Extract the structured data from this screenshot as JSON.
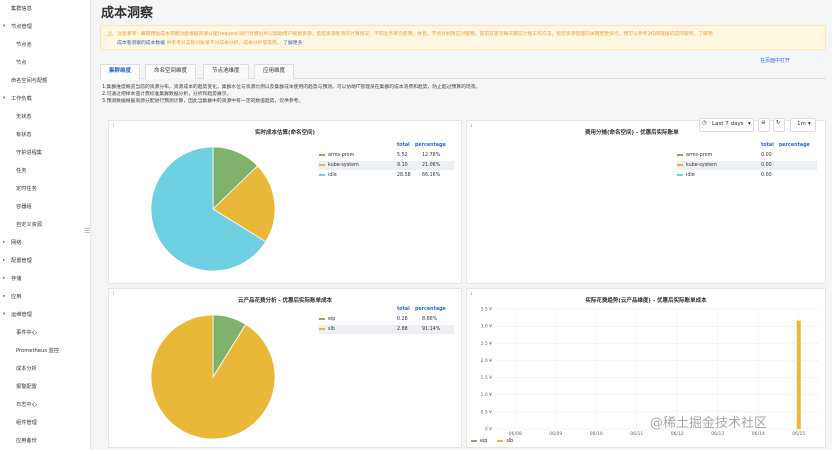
{
  "sidebar": {
    "items": [
      {
        "label": "集群信息",
        "level": 0,
        "caret": ""
      },
      {
        "label": "节点管理",
        "level": 0,
        "caret": "▾"
      },
      {
        "label": "节点池",
        "level": 1,
        "caret": ""
      },
      {
        "label": "节点",
        "level": 1,
        "caret": ""
      },
      {
        "label": "命名空间与配额",
        "level": 0,
        "caret": ""
      },
      {
        "label": "工作负载",
        "level": 0,
        "caret": "▾"
      },
      {
        "label": "无状态",
        "level": 1,
        "caret": ""
      },
      {
        "label": "有状态",
        "level": 1,
        "caret": ""
      },
      {
        "label": "守护进程集",
        "level": 1,
        "caret": ""
      },
      {
        "label": "任务",
        "level": 1,
        "caret": ""
      },
      {
        "label": "定时任务",
        "level": 1,
        "caret": ""
      },
      {
        "label": "容器组",
        "level": 1,
        "caret": ""
      },
      {
        "label": "自定义资源",
        "level": 1,
        "caret": ""
      },
      {
        "label": "网络",
        "level": 0,
        "caret": "▸"
      },
      {
        "label": "配置管理",
        "level": 0,
        "caret": "▸"
      },
      {
        "label": "存储",
        "level": 0,
        "caret": "▸"
      },
      {
        "label": "应用",
        "level": 0,
        "caret": "▸"
      },
      {
        "label": "运维管理",
        "level": 0,
        "caret": "▾"
      },
      {
        "label": "事件中心",
        "level": 1,
        "caret": ""
      },
      {
        "label": "Prometheus 监控",
        "level": 1,
        "caret": ""
      },
      {
        "label": "成本分析",
        "level": 1,
        "caret": ""
      },
      {
        "label": "报警配置",
        "level": 1,
        "caret": ""
      },
      {
        "label": "日志中心",
        "level": 1,
        "caret": ""
      },
      {
        "label": "组件管理",
        "level": 1,
        "caret": ""
      },
      {
        "label": "应用备份",
        "level": 1,
        "caret": ""
      }
    ],
    "collapse_glyph": "☰"
  },
  "page": {
    "title": "成本洞察",
    "open_new": "在页面中打开",
    "watermark": "@稀土掘金技术社区"
  },
  "notice": {
    "line1": "注意事项：每隔预估成本洞察功能根据资源分配(request)进行计费分析以帮助用户规划资源，监控资源各项的计算情况、不同业务单元使用、并且，节点计划用应对策略，提前在首次每天都在计划工作方法，帮您资源管理的关键更更多行，预可以参考对1网链接的实际服务。了解更",
    "line2_link": "成本看洞察的成本数据",
    "line2_text": "供参考对实际对账单不对成本分析、成本分析等等用。",
    "line2_link2": "了解更多",
    "warn_icon": "⚠"
  },
  "tabs": [
    {
      "label": "集群维度",
      "active": true
    },
    {
      "label": "命名空间维度",
      "active": false
    },
    {
      "label": "节点池维度",
      "active": false
    },
    {
      "label": "应用维度",
      "active": false
    }
  ],
  "description": [
    "1.集群维度概览当前的资源分布，资源成本的趋势变化，集群水位与资源比例以及集群成本使用的趋势与预测。可以协助IT管理员在集群的成本消费和趋势，防止超过预算的场景。",
    "2.可通过把样本值计费标准集群数据分析，分析和趋势展示。",
    "3.预测数据根据资源分配进行预测计算，因此当集群中的资源中有一定的数值趋势，仅供参考。"
  ],
  "panels": {
    "p1": {
      "title": "实时成本估算(命名空间)",
      "info": "i",
      "legend_head": {
        "total": "total",
        "percentage": "percentage"
      },
      "rows": [
        {
          "name": "arms-prom",
          "total": "5.52",
          "pct": "12.78%",
          "color": "#7eb26d"
        },
        {
          "name": "kube-system",
          "total": "9.10",
          "pct": "21.06%",
          "color": "#eab839"
        },
        {
          "name": "idle",
          "total": "28.58",
          "pct": "66.16%",
          "color": "#6ed0e0"
        }
      ]
    },
    "p2": {
      "title": "费用分摊(命名空间) - 优惠后实际账单",
      "info": "i",
      "time_label": "Last 7 days",
      "clock_icon": "◷",
      "chev_icon": "▾",
      "zoom_icon": "⊖",
      "refresh_icon": "↻",
      "interval": "1m",
      "legend_head": {
        "total": "total",
        "percentage": "percentage"
      },
      "rows": [
        {
          "name": "arms-prom",
          "total": "0.00",
          "color": "#7eb26d"
        },
        {
          "name": "kube-system",
          "total": "0.00",
          "color": "#eab839"
        },
        {
          "name": "idle",
          "total": "0.00",
          "color": "#6ed0e0"
        }
      ]
    },
    "p3": {
      "title": "云产品花费分析 - 优惠后实际账单成本",
      "info": "i",
      "legend_head": {
        "total": "total",
        "percentage": "percentage"
      },
      "rows": [
        {
          "name": "eip",
          "total": "0.28",
          "pct": "8.86%",
          "color": "#7eb26d"
        },
        {
          "name": "slb",
          "total": "2.88",
          "pct": "91.14%",
          "color": "#eab839"
        }
      ]
    },
    "p4": {
      "title": "实际花费趋势(云产品维度) - 优惠后实际账单成本",
      "info": "i",
      "legend": [
        {
          "name": "eip",
          "color": "#7eb26d"
        },
        {
          "name": "slb",
          "color": "#eab839"
        }
      ]
    }
  },
  "chart_data": [
    {
      "type": "pie",
      "title": "实时成本估算(命名空间)",
      "labels": [
        "arms-prom",
        "kube-system",
        "idle"
      ],
      "values": [
        5.52,
        9.1,
        28.58
      ],
      "percentages": [
        12.78,
        21.06,
        66.16
      ],
      "colors": [
        "#7eb26d",
        "#eab839",
        "#6ed0e0"
      ],
      "legend": "right"
    },
    {
      "type": "pie",
      "title": "云产品花费分析 - 优惠后实际账单成本",
      "labels": [
        "eip",
        "slb"
      ],
      "values": [
        0.28,
        2.88
      ],
      "percentages": [
        8.86,
        91.14
      ],
      "colors": [
        "#7eb26d",
        "#eab839"
      ],
      "legend": "right"
    },
    {
      "type": "bar",
      "title": "实际花费趋势(云产品维度) - 优惠后实际账单成本",
      "categories": [
        "06/08",
        "06/09",
        "06/10",
        "06/11",
        "06/12",
        "06/13",
        "06/14",
        "06/15"
      ],
      "series": [
        {
          "name": "eip",
          "values": [
            0,
            0,
            0,
            0,
            0,
            0,
            0,
            0
          ]
        },
        {
          "name": "slb",
          "values": [
            0,
            0,
            0,
            0,
            0,
            0,
            0,
            3.16
          ]
        }
      ],
      "y_ticks": [
        "0 ¥",
        "0.5 ¥",
        "1.0 ¥",
        "1.5 ¥",
        "2.0 ¥",
        "2.5 ¥",
        "3.0 ¥",
        "3.5 ¥"
      ],
      "ylim": [
        0,
        3.5
      ],
      "grid": true,
      "legend": "bottom-left"
    }
  ]
}
